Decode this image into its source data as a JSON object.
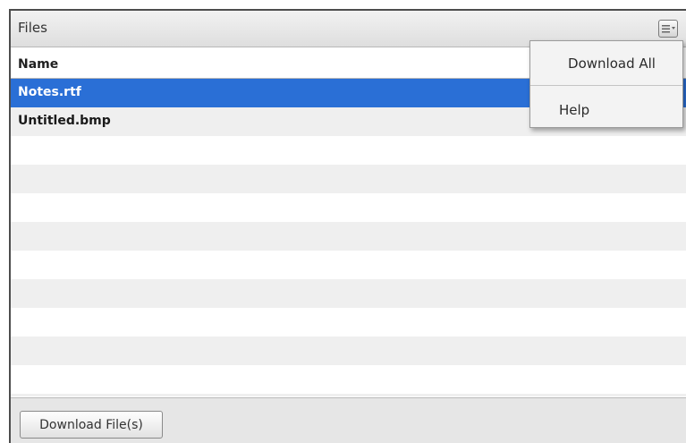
{
  "panel": {
    "title": "Files"
  },
  "table": {
    "column_header": "Name",
    "rows": [
      {
        "name": "Notes.rtf",
        "selected": true
      },
      {
        "name": "Untitled.bmp",
        "selected": false
      },
      {
        "name": "",
        "selected": false
      },
      {
        "name": "",
        "selected": false
      },
      {
        "name": "",
        "selected": false
      },
      {
        "name": "",
        "selected": false
      },
      {
        "name": "",
        "selected": false
      },
      {
        "name": "",
        "selected": false
      },
      {
        "name": "",
        "selected": false
      },
      {
        "name": "",
        "selected": false
      },
      {
        "name": "",
        "selected": false
      },
      {
        "name": "",
        "selected": false
      }
    ]
  },
  "footer": {
    "download_button_label": "Download File(s)"
  },
  "menu": {
    "button_icon": "menu-list-icon",
    "items": [
      {
        "label": "Download All"
      },
      {
        "label": "Help"
      }
    ]
  },
  "colors": {
    "selection": "#2a6fd6"
  }
}
